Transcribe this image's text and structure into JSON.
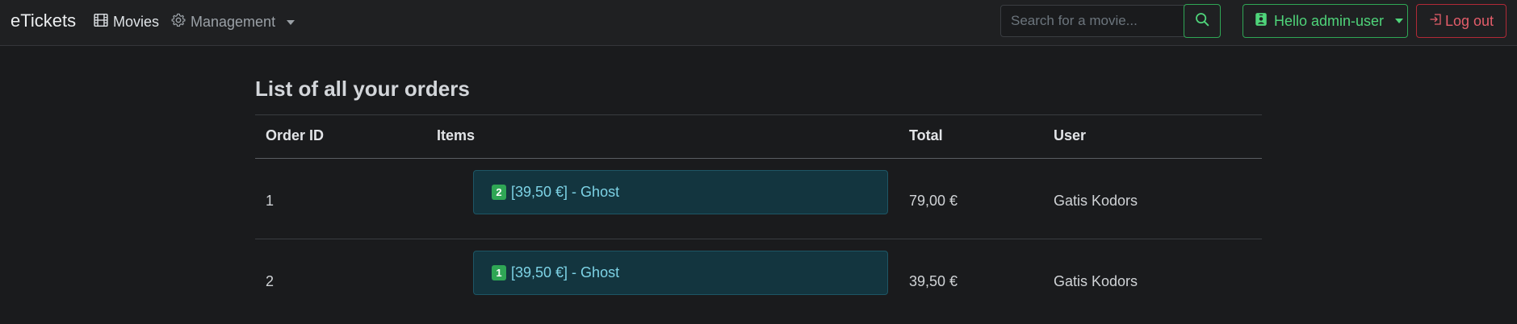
{
  "navbar": {
    "brand": "eTickets",
    "movies_label": "Movies",
    "management_label": "Management",
    "search_placeholder": "Search for a movie...",
    "user_label": "Hello admin-user",
    "logout_label": "Log out",
    "colors": {
      "success": "#2fa655",
      "danger": "#b02a37",
      "info_bg": "#13353f"
    }
  },
  "page": {
    "title": "List of all your orders"
  },
  "table": {
    "headers": [
      "Order ID",
      "Items",
      "Total",
      "User"
    ],
    "rows": [
      {
        "order_id": "1",
        "item_qty": "2",
        "item_text": "[39,50 €] - Ghost",
        "total": "79,00 €",
        "user": "Gatis Kodors"
      },
      {
        "order_id": "2",
        "item_qty": "1",
        "item_text": "[39,50 €] - Ghost",
        "total": "39,50 €",
        "user": "Gatis Kodors"
      }
    ]
  },
  "icons": [
    "film-icon",
    "gear-icon",
    "search-icon",
    "person-badge-icon",
    "logout-icon"
  ]
}
